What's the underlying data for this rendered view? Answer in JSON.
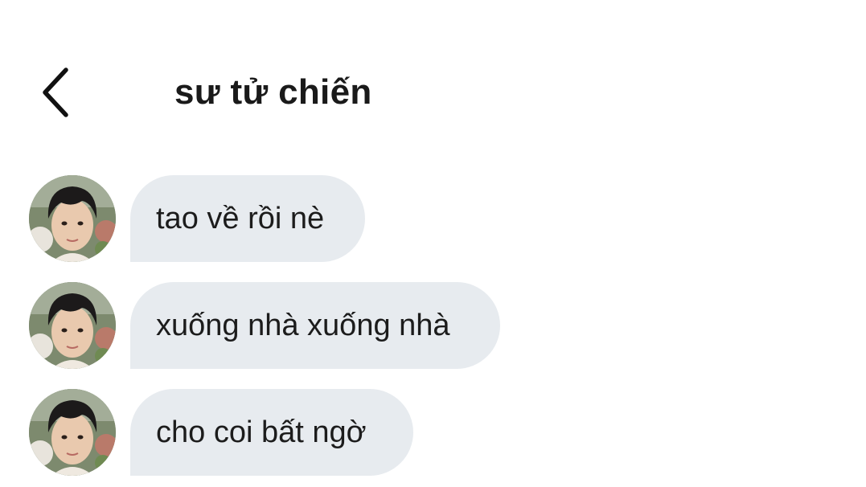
{
  "header": {
    "title": "sư tử chiến",
    "back_icon": "chevron-left-icon"
  },
  "messages": [
    {
      "text": "tao về rồi nè",
      "avatar_icon": "avatar-photo"
    },
    {
      "text": "xuống nhà xuống nhà",
      "avatar_icon": "avatar-photo"
    },
    {
      "text": "cho coi bất ngờ",
      "avatar_icon": "avatar-photo"
    }
  ],
  "colors": {
    "bubble_background": "#e7ebef",
    "text": "#1a1a1a",
    "background": "#ffffff"
  }
}
